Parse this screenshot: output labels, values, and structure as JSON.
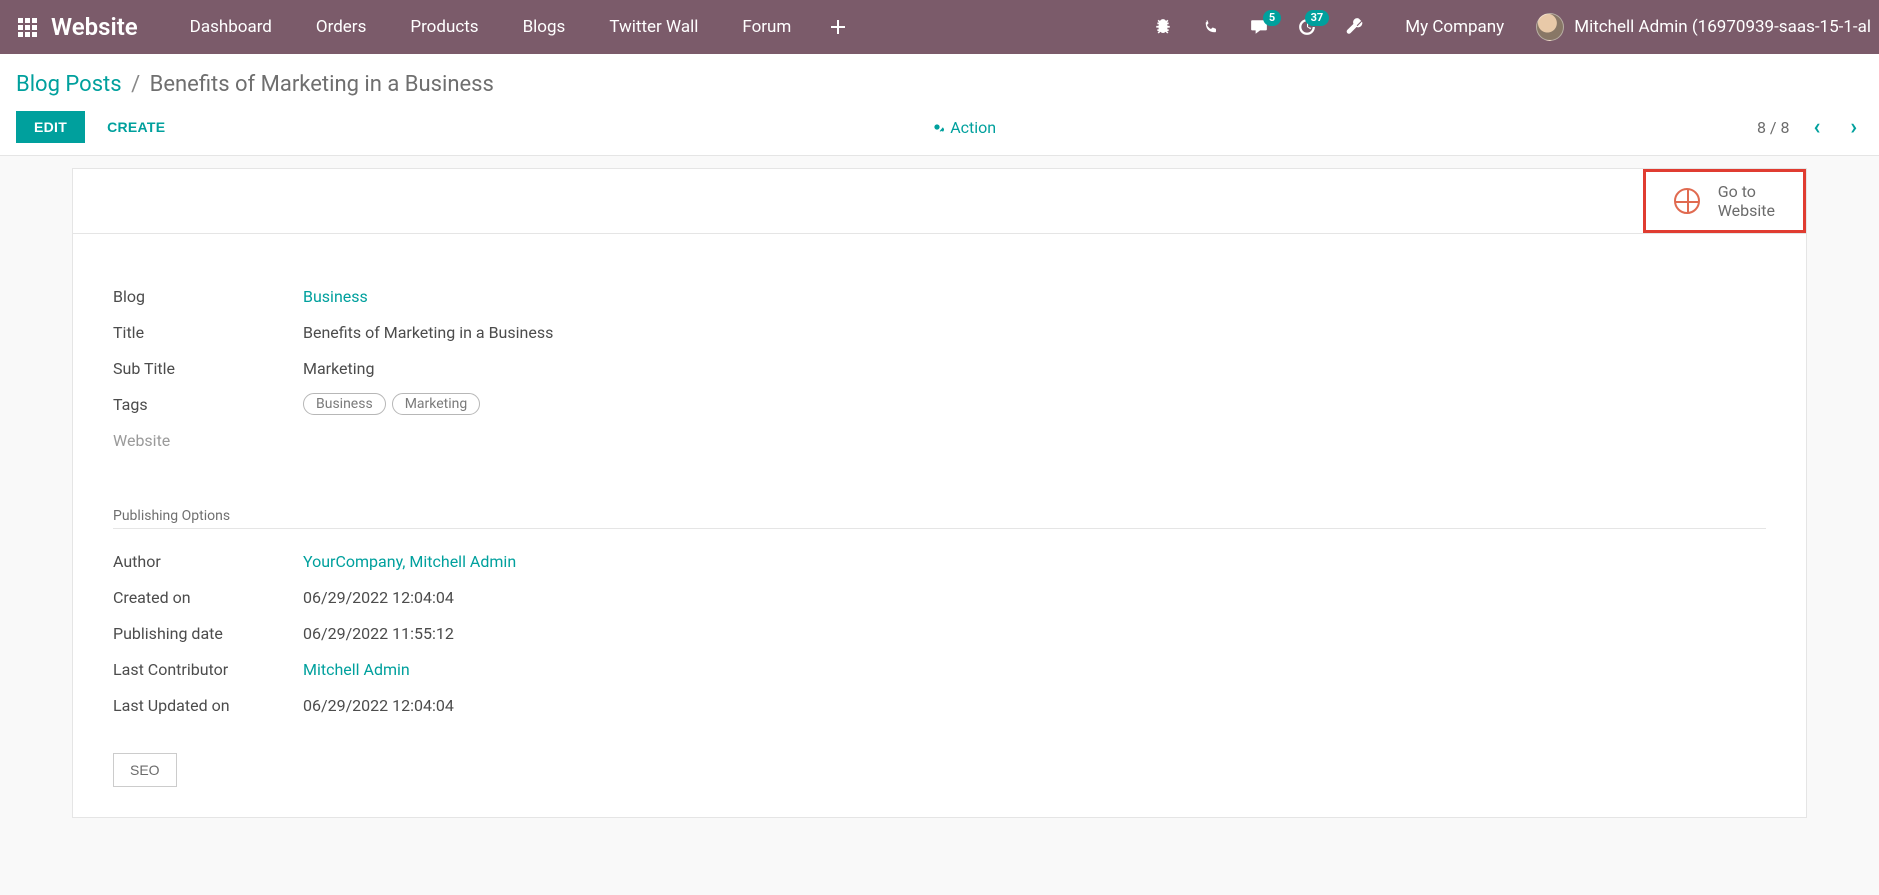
{
  "topbar": {
    "brand": "Website",
    "menu": [
      "Dashboard",
      "Orders",
      "Products",
      "Blogs",
      "Twitter Wall",
      "Forum"
    ],
    "messages_badge": "5",
    "activities_badge": "37",
    "company": "My Company",
    "username": "Mitchell Admin (16970939-saas-15-1-al"
  },
  "breadcrumb": {
    "root": "Blog Posts",
    "sep": "/",
    "current": "Benefits of Marketing in a Business"
  },
  "controls": {
    "edit": "EDIT",
    "create": "CREATE",
    "action": "Action",
    "pager": "8 / 8"
  },
  "sheet": {
    "goto_line1": "Go to",
    "goto_line2": "Website",
    "fields": {
      "blog_label": "Blog",
      "blog_value": "Business",
      "title_label": "Title",
      "title_value": "Benefits of Marketing in a Business",
      "subtitle_label": "Sub Title",
      "subtitle_value": "Marketing",
      "tags_label": "Tags",
      "tags": [
        "Business",
        "Marketing"
      ],
      "website_label": "Website"
    },
    "publishing": {
      "heading": "Publishing Options",
      "author_label": "Author",
      "author_value": "YourCompany, Mitchell Admin",
      "created_label": "Created on",
      "created_value": "06/29/2022 12:04:04",
      "pubdate_label": "Publishing date",
      "pubdate_value": "06/29/2022 11:55:12",
      "lastcontrib_label": "Last Contributor",
      "lastcontrib_value": "Mitchell Admin",
      "lastupdated_label": "Last Updated on",
      "lastupdated_value": "06/29/2022 12:04:04"
    },
    "seo_button": "SEO"
  }
}
